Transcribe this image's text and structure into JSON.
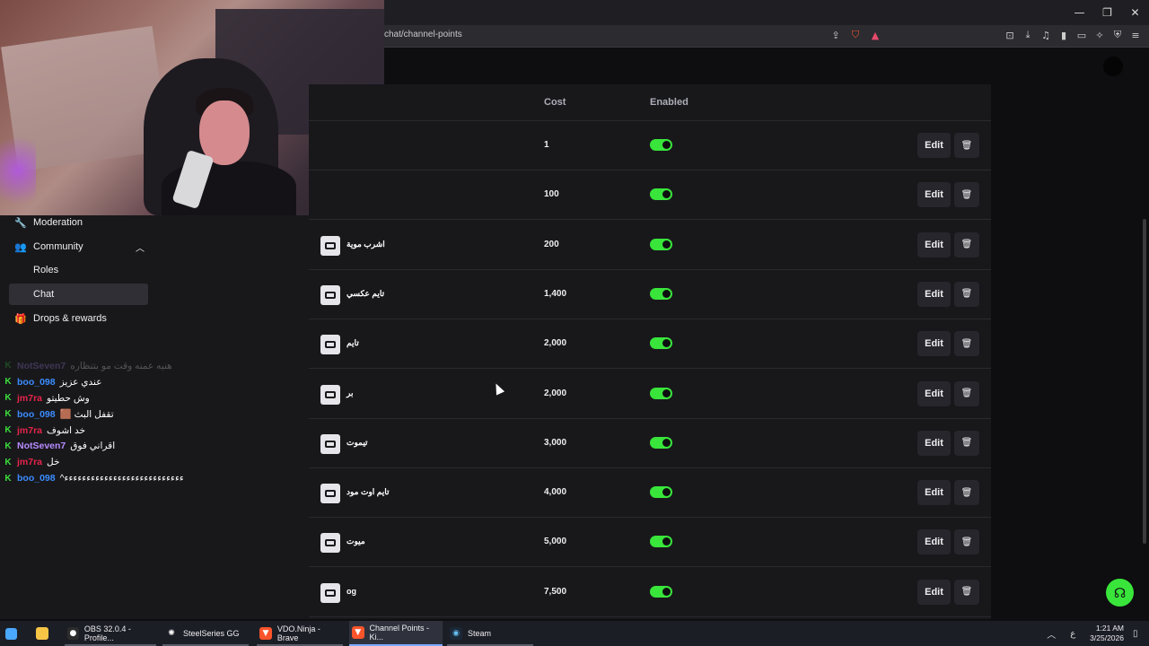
{
  "browser": {
    "url_fragment": "chat/channel-points",
    "window_controls": [
      "—",
      "❐",
      "✕"
    ]
  },
  "sidebar": {
    "items": [
      {
        "label": "Moderation",
        "icon": "wrench-icon",
        "glyph": "🔧"
      },
      {
        "label": "Community",
        "icon": "people-icon",
        "glyph": "👥",
        "expanded": true
      },
      {
        "label": "Roles",
        "sub": true
      },
      {
        "label": "Chat",
        "sub": true,
        "active": true
      },
      {
        "label": "Drops & rewards",
        "icon": "gift-icon",
        "glyph": "🎁"
      }
    ]
  },
  "chat": {
    "lines": [
      {
        "user": "NotSeven7",
        "color": "#b88cff",
        "msg": "هنيه عمنه وقت مو بتنظاره",
        "faded": true
      },
      {
        "user": "boo_098",
        "color": "#3b8cff",
        "msg": "عندي عزيز"
      },
      {
        "user": "jm7ra",
        "color": "#e8244a",
        "msg": "وش حطيتو"
      },
      {
        "user": "boo_098",
        "color": "#3b8cff",
        "msg": "تقفل البث 🟫"
      },
      {
        "user": "jm7ra",
        "color": "#e8244a",
        "msg": "خد اشوف"
      },
      {
        "user": "NotSeven7",
        "color": "#b88cff",
        "msg": "اقراني فوق"
      },
      {
        "user": "jm7ra",
        "color": "#e8244a",
        "msg": "خل"
      },
      {
        "user": "boo_098",
        "color": "#3b8cff",
        "msg": "ءءءءءءءءءءءءءءءءءءءءءءءءءءء^"
      }
    ]
  },
  "table": {
    "headers": {
      "cost": "Cost",
      "enabled": "Enabled"
    },
    "edit_label": "Edit",
    "rows": [
      {
        "name": "",
        "cost": "1",
        "enabled": true
      },
      {
        "name": "",
        "cost": "100",
        "enabled": true
      },
      {
        "name": "اشرب موية",
        "cost": "200",
        "enabled": true
      },
      {
        "name": "تايم عكسي",
        "cost": "1,400",
        "enabled": true
      },
      {
        "name": "تايم",
        "cost": "2,000",
        "enabled": true
      },
      {
        "name": "بر",
        "cost": "2,000",
        "enabled": true
      },
      {
        "name": "تيموت",
        "cost": "3,000",
        "enabled": true
      },
      {
        "name": "تايم اوت مود",
        "cost": "4,000",
        "enabled": true
      },
      {
        "name": "ميوت",
        "cost": "5,000",
        "enabled": true
      },
      {
        "name": "og",
        "cost": "7,500",
        "enabled": true
      }
    ]
  },
  "taskbar": {
    "items": [
      {
        "label": "OBS 32.0.4 - Profile...",
        "icon": "obs-icon",
        "glyph": "●",
        "icbg": "#2c2c2c",
        "iccolor": "#ffffff"
      },
      {
        "label": "SteelSeries GG",
        "icon": "steelseries-icon",
        "glyph": "✺",
        "icbg": "transparent",
        "iccolor": "#ffffff"
      },
      {
        "label": "VDO.Ninja - Brave",
        "icon": "brave-icon",
        "glyph": "▼",
        "icbg": "#fb542b",
        "iccolor": "#ffffff"
      },
      {
        "label": "Channel Points - Ki...",
        "icon": "brave-icon",
        "glyph": "▼",
        "icbg": "#fb542b",
        "iccolor": "#ffffff",
        "active": true
      },
      {
        "label": "Steam",
        "icon": "steam-icon",
        "glyph": "◉",
        "icbg": "#1b2838",
        "iccolor": "#66c0f4"
      }
    ],
    "time": "1:21 AM",
    "date": "3/25/2026",
    "lang": "ع"
  }
}
